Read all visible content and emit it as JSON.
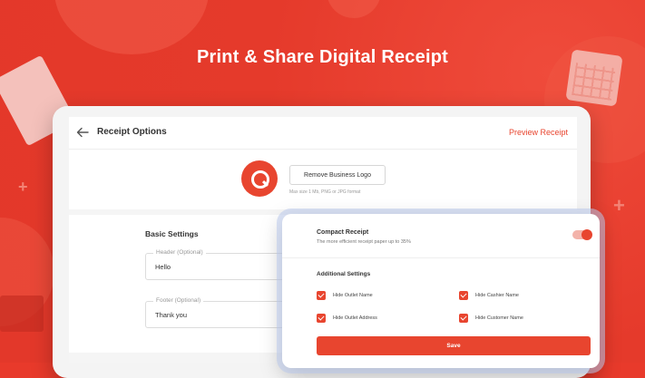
{
  "headline": "Print & Share Digital Receipt",
  "topbar": {
    "title": "Receipt Options",
    "preview_label": "Preview Receipt"
  },
  "logo_section": {
    "remove_label": "Remove Business Logo",
    "hint": "Max size 1 Mb, PNG or JPG format"
  },
  "basic_settings": {
    "title": "Basic Settings",
    "header_label": "Header (Optional)",
    "header_value": "Hello",
    "footer_label": "Footer (Optional)",
    "footer_value": "Thank you"
  },
  "compact": {
    "title": "Compact Receipt",
    "desc": "The more efficient receipt paper up to 35%",
    "enabled": true
  },
  "additional": {
    "title": "Additional Settings",
    "options": [
      {
        "label": "Hide Outlet Name",
        "checked": true
      },
      {
        "label": "Hide Cashier Name",
        "checked": true
      },
      {
        "label": "Hide Outlet Address",
        "checked": true
      },
      {
        "label": "Hide Customer Name",
        "checked": true
      }
    ]
  },
  "save_label": "Save",
  "colors": {
    "accent": "#e8452f",
    "background": "#e3382a"
  },
  "icons": {
    "back": "arrow-left-icon",
    "logo": "qasir-logo-icon"
  }
}
